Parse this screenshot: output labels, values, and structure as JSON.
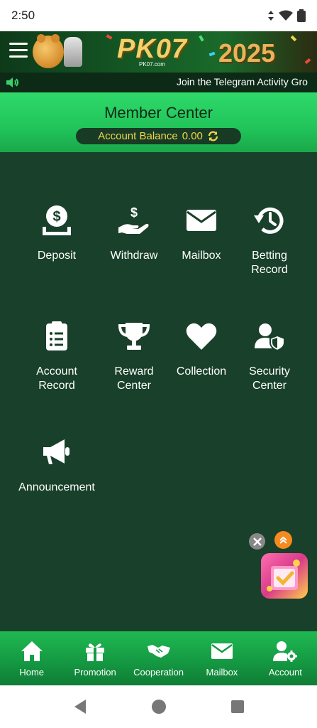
{
  "status_bar": {
    "time": "2:50"
  },
  "banner": {
    "logo": "PK07",
    "logo_sub": "PK07.com",
    "year": "2025"
  },
  "ticker": {
    "text": "Join the Telegram Activity Gro"
  },
  "member_center": {
    "title": "Member Center",
    "balance_label": "Account Balance",
    "balance_value": "0.00"
  },
  "menu": [
    {
      "label": "Deposit",
      "icon": "deposit-icon"
    },
    {
      "label": "Withdraw",
      "icon": "withdraw-icon"
    },
    {
      "label": "Mailbox",
      "icon": "mail-icon"
    },
    {
      "label": "Betting\nRecord",
      "icon": "history-icon"
    },
    {
      "label": "Account\nRecord",
      "icon": "clipboard-icon"
    },
    {
      "label": "Reward\nCenter",
      "icon": "trophy-icon"
    },
    {
      "label": "Collection",
      "icon": "heart-icon"
    },
    {
      "label": "Security\nCenter",
      "icon": "user-shield-icon"
    },
    {
      "label": "Announcement",
      "icon": "megaphone-icon"
    }
  ],
  "bottom_nav": [
    {
      "label": "Home",
      "icon": "home-icon"
    },
    {
      "label": "Promotion",
      "icon": "gift-icon"
    },
    {
      "label": "Cooperation",
      "icon": "handshake-icon"
    },
    {
      "label": "Mailbox",
      "icon": "mail-icon"
    },
    {
      "label": "Account",
      "icon": "user-gear-icon"
    }
  ],
  "colors": {
    "main_bg": "#19402a",
    "header_green": "#21c45a",
    "balance_text": "#f2d54a",
    "float_up": "#f58a1f"
  }
}
